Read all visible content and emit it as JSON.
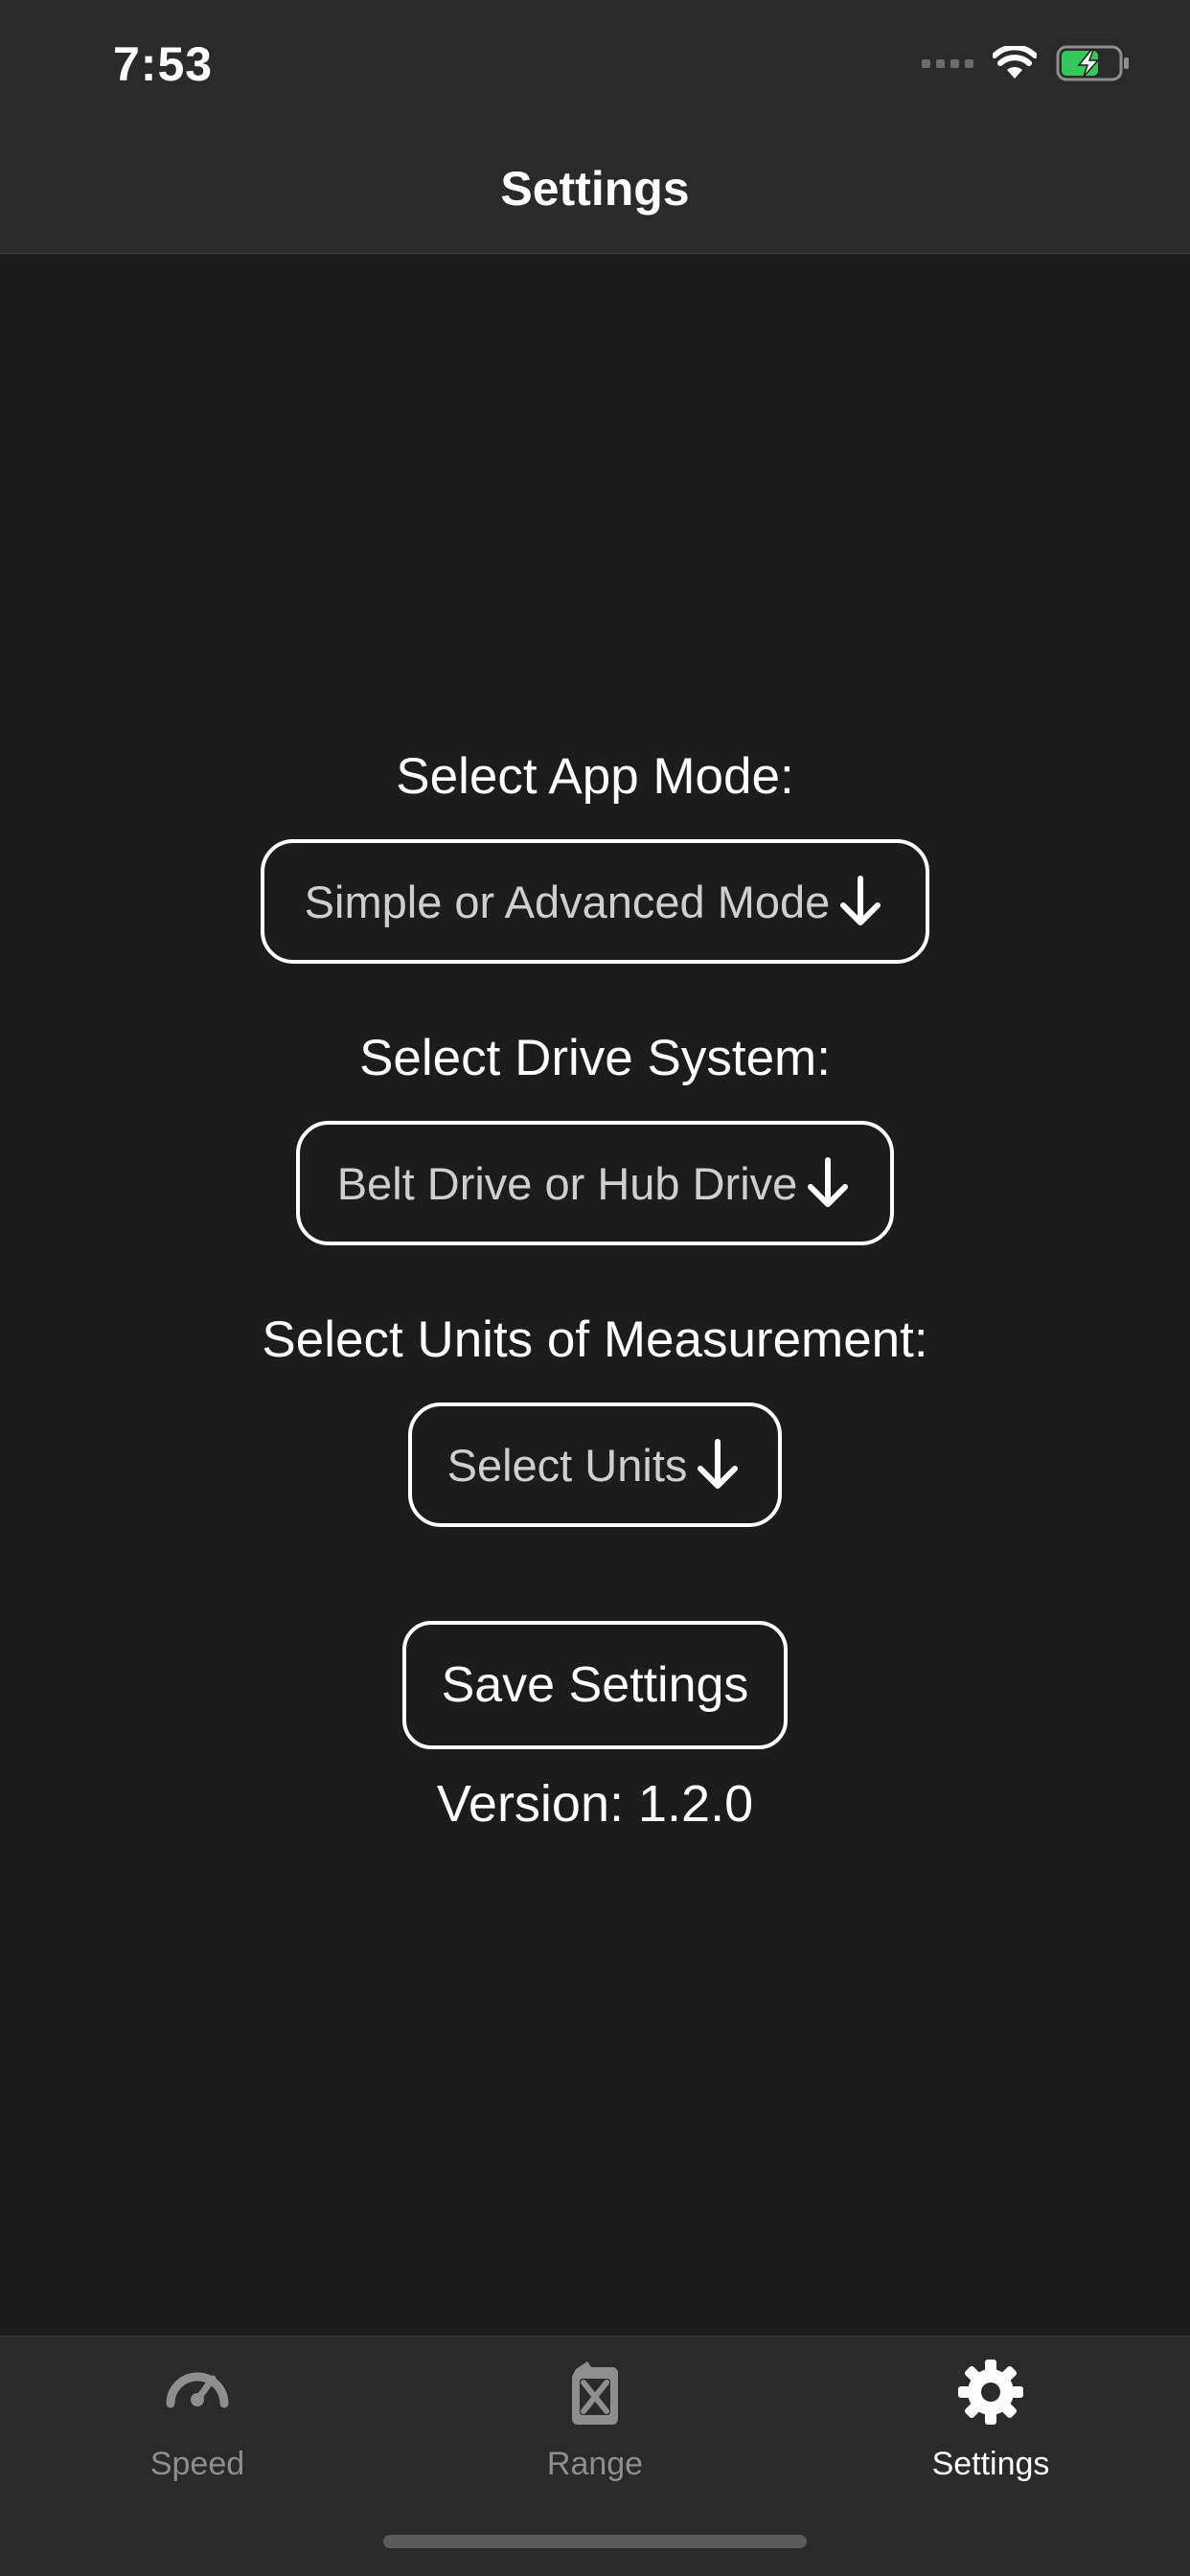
{
  "status_bar": {
    "time": "7:53",
    "icons": [
      "signal-icon",
      "wifi-icon",
      "battery-charging-icon"
    ],
    "battery_color": "#34c759"
  },
  "nav": {
    "title": "Settings"
  },
  "form": {
    "app_mode": {
      "label": "Select App Mode:",
      "placeholder": "Simple or Advanced Mode"
    },
    "drive_system": {
      "label": "Select Drive System:",
      "placeholder": "Belt Drive or Hub Drive"
    },
    "units": {
      "label": "Select Units of Measurement:",
      "placeholder": "Select Units"
    },
    "save_label": "Save Settings",
    "version_text": "Version: 1.2.0"
  },
  "tabbar": {
    "tabs": [
      {
        "label": "Speed",
        "icon": "speedometer-icon",
        "active": false
      },
      {
        "label": "Range",
        "icon": "fuel-can-icon",
        "active": false
      },
      {
        "label": "Settings",
        "icon": "gear-icon",
        "active": true
      }
    ]
  },
  "colors": {
    "background": "#1c1c1c",
    "bar": "#2a2a2a",
    "inactive_tab": "#8e8e8e",
    "active_tab": "#ffffff"
  }
}
